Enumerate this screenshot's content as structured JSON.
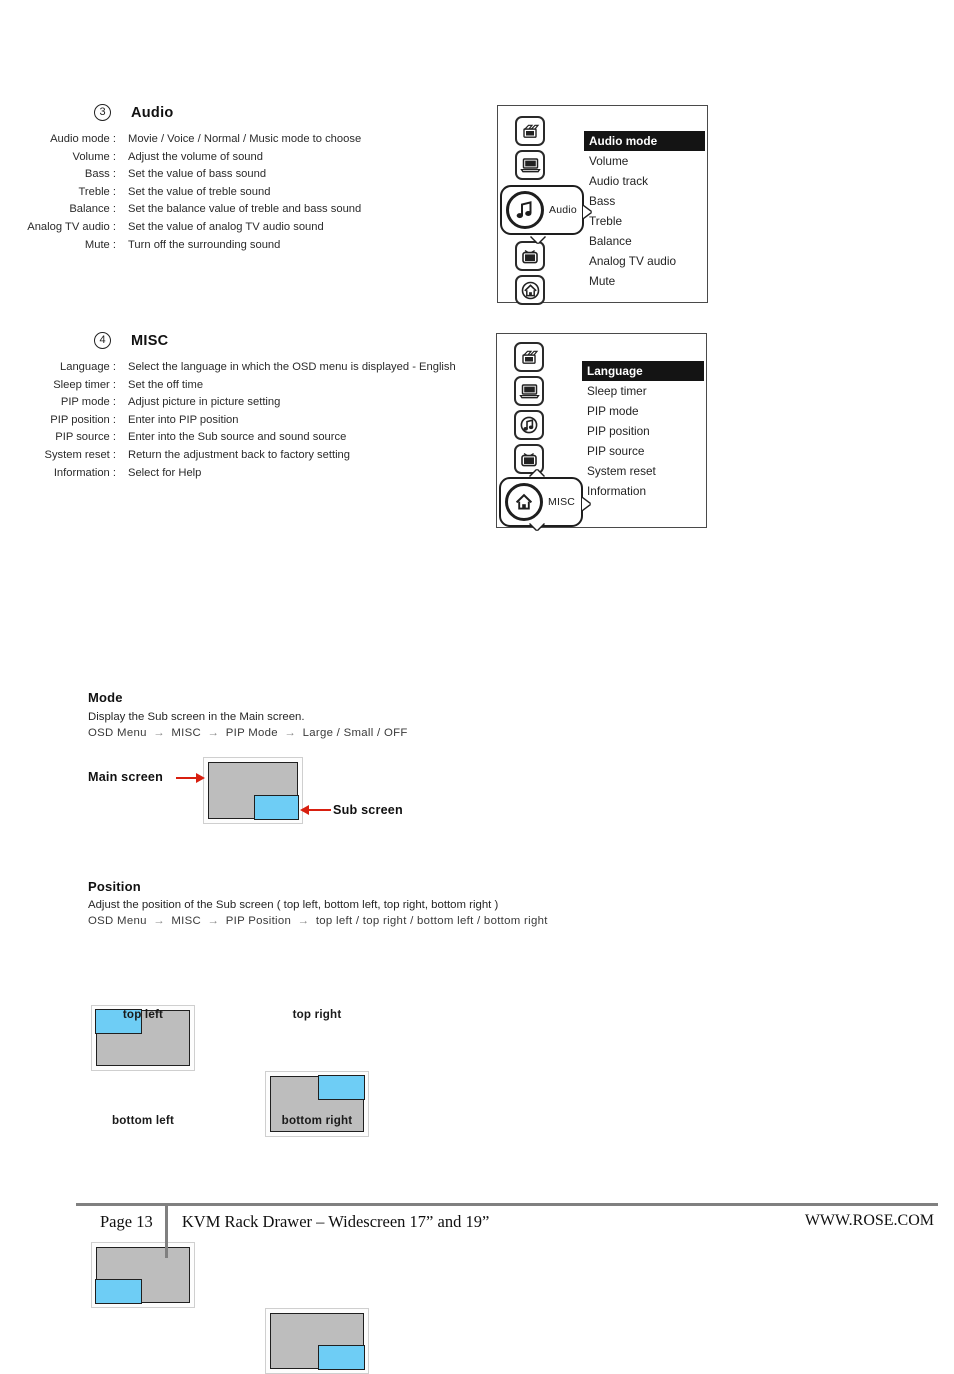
{
  "sections": [
    {
      "number": "3",
      "title": "Audio",
      "rows": [
        {
          "term": "Audio mode :",
          "desc": "Movie / Voice / Normal / Music mode to choose"
        },
        {
          "term": "Volume :",
          "desc": "Adjust the volume of sound"
        },
        {
          "term": "Bass :",
          "desc": "Set the value of bass sound"
        },
        {
          "term": "Treble :",
          "desc": "Set the value of treble sound"
        },
        {
          "term": "Balance :",
          "desc": "Set the balance value of treble and bass sound"
        },
        {
          "term": "Analog TV audio :",
          "desc": "Set the value of analog TV audio sound"
        },
        {
          "term": "Mute :",
          "desc": "Turn off the surrounding sound"
        }
      ]
    },
    {
      "number": "4",
      "title": "MISC",
      "rows": [
        {
          "term": "Language :",
          "desc": "Select the language in which the OSD menu is displayed - English"
        },
        {
          "term": "Sleep timer :",
          "desc": "Set the off time"
        },
        {
          "term": "PIP mode :",
          "desc": "Adjust picture in picture setting"
        },
        {
          "term": "PIP position :",
          "desc": "Enter into PIP position"
        },
        {
          "term": "PIP source :",
          "desc": "Enter into the Sub source and sound source"
        },
        {
          "term": "System reset :",
          "desc": "Return the adjustment back to factory setting"
        },
        {
          "term": "Information :",
          "desc": "Select for Help"
        }
      ]
    }
  ],
  "osd_audio": {
    "selected_icon_label": "Audio",
    "selected_icon_name": "music-note-icon",
    "icons_above": [
      "film-camera-icon",
      "laptop-icon"
    ],
    "icons_below": [
      "tv-icon",
      "home-icon"
    ],
    "items": [
      {
        "label": "Audio mode",
        "selected": true
      },
      {
        "label": "Volume",
        "selected": false
      },
      {
        "label": "Audio track",
        "selected": false
      },
      {
        "label": "Bass",
        "selected": false
      },
      {
        "label": "Treble",
        "selected": false
      },
      {
        "label": "Balance",
        "selected": false
      },
      {
        "label": "Analog TV audio",
        "selected": false
      },
      {
        "label": "Mute",
        "selected": false
      }
    ]
  },
  "osd_misc": {
    "selected_icon_label": "MISC",
    "selected_icon_name": "home-icon",
    "icons_above": [
      "film-camera-icon",
      "laptop-icon",
      "music-note-icon",
      "tv-icon"
    ],
    "icons_below": [],
    "items": [
      {
        "label": "Language",
        "selected": true
      },
      {
        "label": "Sleep timer",
        "selected": false
      },
      {
        "label": "PIP mode",
        "selected": false
      },
      {
        "label": "PIP position",
        "selected": false
      },
      {
        "label": "PIP source",
        "selected": false
      },
      {
        "label": "System reset",
        "selected": false
      },
      {
        "label": "Information",
        "selected": false
      }
    ]
  },
  "mode": {
    "heading": "Mode",
    "description": "Display the Sub screen in the Main screen.",
    "path": {
      "start": "OSD Menu",
      "step1": "MISC",
      "step2": "PIP Mode",
      "options": "Large  /  Small  /  OFF"
    },
    "main_label": "Main screen",
    "sub_label": "Sub screen"
  },
  "position": {
    "heading": "Position",
    "description": "Adjust the position of the Sub screen  ( top left, bottom left, top right, bottom right )",
    "path": {
      "start": "OSD Menu",
      "step1": "MISC",
      "step2": "PIP Position",
      "options": "top left  /  top right  /  bottom left  /  bottom right"
    },
    "diagrams": [
      {
        "label": "top left",
        "pos": "top-left"
      },
      {
        "label": "top right",
        "pos": "top-right"
      },
      {
        "label": "bottom left",
        "pos": "bottom-left"
      },
      {
        "label": "bottom right",
        "pos": "bottom-right"
      }
    ]
  },
  "footer": {
    "page": "Page 13",
    "title": "KVM Rack Drawer – Widescreen  17” and 19”",
    "url": "WWW.ROSE.COM"
  },
  "colors": {
    "sub_screen_blue": "#6ecdf5",
    "main_screen_gray": "#bdbdbd",
    "arrow_red": "#d81f0f",
    "osd_highlight": "#141414",
    "footer_rule": "#808080"
  }
}
